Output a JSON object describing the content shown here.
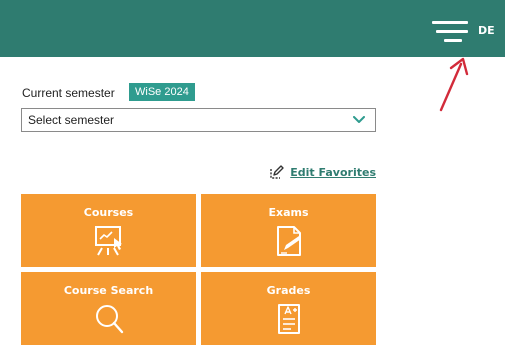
{
  "header": {
    "language": "DE",
    "colors": {
      "background": "#2f7c70",
      "foreground": "#ffffff"
    },
    "menu_icon": "hamburger-menu-icon"
  },
  "annotation": {
    "arrow_color": "#d22b3a"
  },
  "semester": {
    "label": "Current semester",
    "badge": "WiSe 2024",
    "badge_color": "#2f9c8f",
    "select_value": "Select semester",
    "select_icon": "chevron-down-icon"
  },
  "favorites": {
    "edit_label": "Edit Favorites",
    "icon": "edit-favorites-icon",
    "color": "#2f7c70"
  },
  "tiles": {
    "color": "#f59a31",
    "items": [
      {
        "label": "Courses",
        "icon": "presentation-board-icon"
      },
      {
        "label": "Exams",
        "icon": "exam-sign-icon"
      },
      {
        "label": "Course Search",
        "icon": "search-icon"
      },
      {
        "label": "Grades",
        "icon": "grade-document-icon"
      }
    ]
  }
}
